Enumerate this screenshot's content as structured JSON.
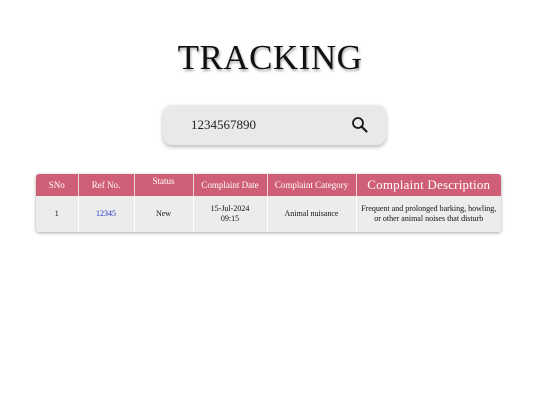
{
  "page": {
    "title": "TRACKING"
  },
  "search": {
    "value": "1234567890",
    "icon": "search-icon"
  },
  "table": {
    "columns": [
      "SNo",
      "Ref No.",
      "Status",
      "Complaint Date",
      "Complaint Category",
      "Complaint  Description"
    ],
    "rows": [
      {
        "sno": "1",
        "ref_no": "12345",
        "status": "New",
        "date": "15-Jul-2024",
        "time": "09:15",
        "category": "Animal nuisance",
        "description": "Frequent and prolonged barking, howling, or other animal noises that disturb"
      }
    ]
  },
  "colors": {
    "header_bg": "#cf5f77",
    "row_bg": "#ececec",
    "search_bg": "#e9e9e9",
    "link": "#2233cc"
  }
}
